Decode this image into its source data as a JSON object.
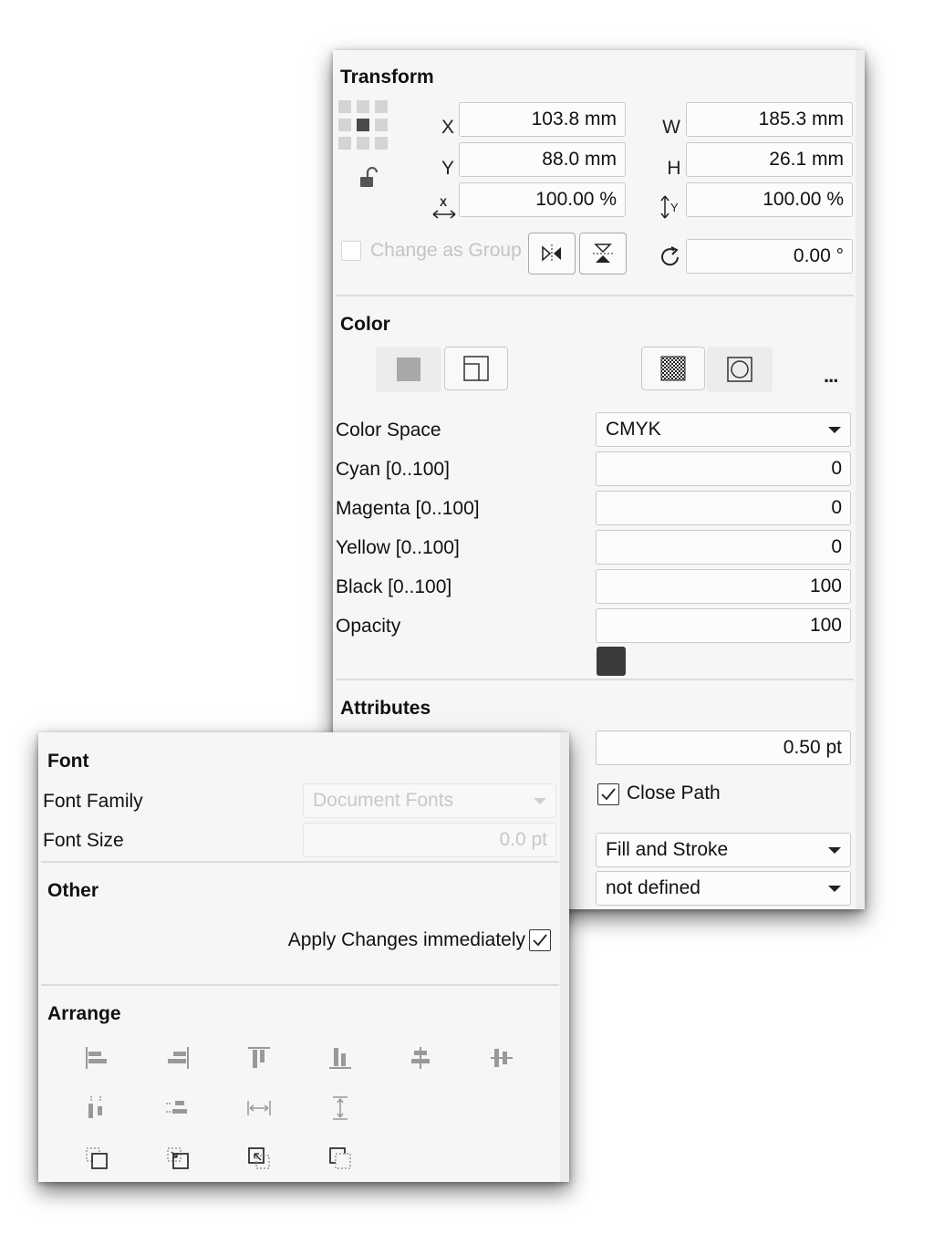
{
  "transform": {
    "title": "Transform",
    "x_label": "X",
    "y_label": "Y",
    "w_label": "W",
    "h_label": "H",
    "x_value": "103.8 mm",
    "y_value": "88.0 mm",
    "w_value": "185.3 mm",
    "h_value": "26.1 mm",
    "scale_x": "100.00 %",
    "scale_y": "100.00 %",
    "change_as_group": "Change as Group",
    "rotation": "0.00 °"
  },
  "color": {
    "title": "Color",
    "more": "...",
    "color_space_label": "Color Space",
    "color_space_value": "CMYK",
    "cyan_label": "Cyan [0..100]",
    "cyan_value": "0",
    "magenta_label": "Magenta [0..100]",
    "magenta_value": "0",
    "yellow_label": "Yellow [0..100]",
    "yellow_value": "0",
    "black_label": "Black [0..100]",
    "black_value": "100",
    "opacity_label": "Opacity",
    "opacity_value": "100",
    "swatch_color": "#3a3a3a"
  },
  "attributes": {
    "title": "Attributes",
    "line_width": "0.50 pt",
    "close_path": "Close Path",
    "close_path_checked": true,
    "mode": "Fill and Stroke",
    "style": "not defined"
  },
  "font": {
    "title": "Font",
    "family_label": "Font Family",
    "family_value": "Document Fonts",
    "size_label": "Font Size",
    "size_value": "0.0 pt"
  },
  "other": {
    "title": "Other",
    "apply_label": "Apply Changes immediately",
    "apply_checked": true
  },
  "arrange": {
    "title": "Arrange",
    "icons": [
      "align-left-icon",
      "align-right-icon",
      "align-top-icon",
      "align-bottom-icon",
      "align-center-vertical-icon",
      "align-center-horizontal-icon",
      "distribute-horizontal-icon",
      "distribute-vertical-icon",
      "equal-width-icon",
      "equal-height-icon",
      "bring-to-front-icon",
      "bring-forward-icon",
      "send-backward-icon",
      "send-to-back-icon"
    ]
  }
}
